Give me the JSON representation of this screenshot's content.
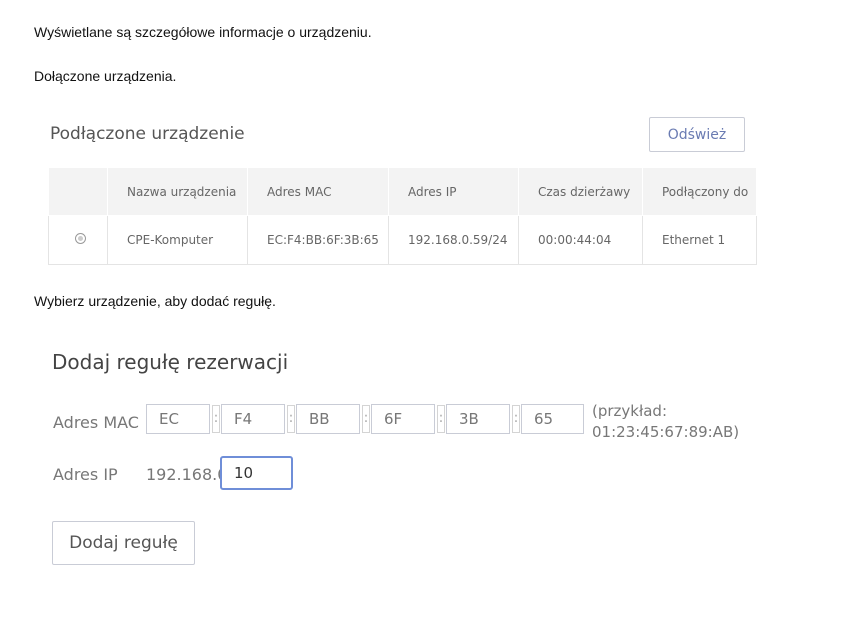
{
  "instructions": {
    "line1": "Wyświetlane są szczegółowe informacje o urządzeniu.",
    "line2": "Dołączone urządzenia.",
    "line3": "Wybierz urządzenie, aby dodać regułę."
  },
  "devices_card": {
    "title": "Podłączone urządzenie",
    "refresh_label": "Odśwież",
    "columns": [
      "Nazwa urządzenia",
      "Adres MAC",
      "Adres IP",
      "Czas dzierżawy",
      "Podłączony do"
    ],
    "rows": [
      {
        "selected": false,
        "name": "CPE-Komputer",
        "mac": "EC:F4:BB:6F:3B:65",
        "ip": "192.168.0.59/24",
        "lease": "00:00:44:04",
        "connected_to": "Ethernet 1"
      }
    ]
  },
  "reservation": {
    "title": "Dodaj regułę rezerwacji",
    "mac_label": "Adres MAC",
    "mac_parts": [
      "EC",
      "F4",
      "BB",
      "6F",
      "3B",
      "65"
    ],
    "separator": ":",
    "example": "(przykład: 01:23:45:67:89:AB)",
    "ip_label": "Adres IP",
    "ip_prefix": "192.168.0.",
    "ip_last_octet": "10",
    "add_button_label": "Dodaj regułę"
  },
  "colors": {
    "accent": "#6f8ed8",
    "refresh_text": "#6a7bb2",
    "table_header_bg": "#f3f3f3"
  }
}
